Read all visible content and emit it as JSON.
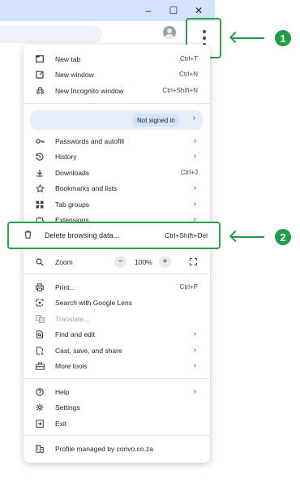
{
  "window": {
    "minimize": "–",
    "maximize": "☐",
    "close": "✕"
  },
  "annotations": {
    "badge1": "1",
    "badge2": "2"
  },
  "colors": {
    "accent_green": "#1f9d45",
    "signin_bg": "#e8eefa"
  },
  "menu": {
    "new_tab": {
      "label": "New tab",
      "shortcut": "Ctrl+T"
    },
    "new_window": {
      "label": "New window",
      "shortcut": "Ctrl+N"
    },
    "new_incognito": {
      "label": "New Incognito window",
      "shortcut": "Ctrl+Shift+N"
    },
    "signin": {
      "label": "Not signed in",
      "chevron": "›"
    },
    "passwords": {
      "label": "Passwords and autofill"
    },
    "history": {
      "label": "History"
    },
    "downloads": {
      "label": "Downloads",
      "shortcut": "Ctrl+J"
    },
    "bookmarks": {
      "label": "Bookmarks and lists"
    },
    "tab_groups": {
      "label": "Tab groups"
    },
    "extensions": {
      "label": "Extensions"
    },
    "delete_data": {
      "label": "Delete browsing data...",
      "shortcut": "Ctrl+Shift+Del"
    },
    "zoom": {
      "label": "Zoom",
      "value": "100%",
      "minus": "−",
      "plus": "+"
    },
    "print": {
      "label": "Print...",
      "shortcut": "Ctrl+P"
    },
    "search_lens": {
      "label": "Search with Google Lens"
    },
    "translate": {
      "label": "Translate..."
    },
    "find_edit": {
      "label": "Find and edit"
    },
    "cast_save": {
      "label": "Cast, save, and share"
    },
    "more_tools": {
      "label": "More tools"
    },
    "help": {
      "label": "Help"
    },
    "settings": {
      "label": "Settings"
    },
    "exit": {
      "label": "Exit"
    },
    "managed": {
      "label": "Profile managed by convo.co.za"
    },
    "chevron": "›"
  }
}
